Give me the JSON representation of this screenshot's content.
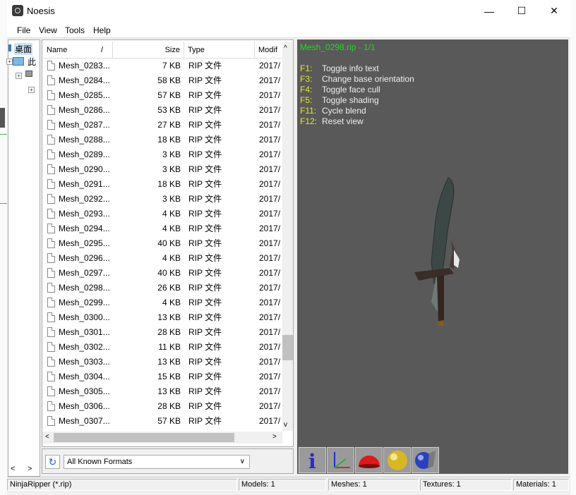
{
  "window": {
    "title": "Noesis",
    "minimize_glyph": "—",
    "maximize_glyph": "☐",
    "close_glyph": "✕"
  },
  "menu": [
    "File",
    "View",
    "Tools",
    "Help"
  ],
  "tree": {
    "desktop_label": "桌面",
    "pc_label": "此",
    "scroll_left": "<",
    "scroll_right": ">"
  },
  "file_list": {
    "columns": {
      "name": "Name",
      "sort_glyph": "/",
      "size": "Size",
      "type": "Type",
      "modified": "Modif"
    },
    "rows": [
      {
        "name": "Mesh_0283...",
        "size": "7 KB",
        "type": "RIP 文件",
        "date": "2017/"
      },
      {
        "name": "Mesh_0284...",
        "size": "58 KB",
        "type": "RIP 文件",
        "date": "2017/"
      },
      {
        "name": "Mesh_0285...",
        "size": "57 KB",
        "type": "RIP 文件",
        "date": "2017/"
      },
      {
        "name": "Mesh_0286...",
        "size": "53 KB",
        "type": "RIP 文件",
        "date": "2017/"
      },
      {
        "name": "Mesh_0287...",
        "size": "27 KB",
        "type": "RIP 文件",
        "date": "2017/"
      },
      {
        "name": "Mesh_0288...",
        "size": "18 KB",
        "type": "RIP 文件",
        "date": "2017/"
      },
      {
        "name": "Mesh_0289...",
        "size": "3 KB",
        "type": "RIP 文件",
        "date": "2017/"
      },
      {
        "name": "Mesh_0290...",
        "size": "3 KB",
        "type": "RIP 文件",
        "date": "2017/"
      },
      {
        "name": "Mesh_0291...",
        "size": "18 KB",
        "type": "RIP 文件",
        "date": "2017/"
      },
      {
        "name": "Mesh_0292...",
        "size": "3 KB",
        "type": "RIP 文件",
        "date": "2017/"
      },
      {
        "name": "Mesh_0293...",
        "size": "4 KB",
        "type": "RIP 文件",
        "date": "2017/"
      },
      {
        "name": "Mesh_0294...",
        "size": "4 KB",
        "type": "RIP 文件",
        "date": "2017/"
      },
      {
        "name": "Mesh_0295...",
        "size": "40 KB",
        "type": "RIP 文件",
        "date": "2017/"
      },
      {
        "name": "Mesh_0296...",
        "size": "4 KB",
        "type": "RIP 文件",
        "date": "2017/"
      },
      {
        "name": "Mesh_0297...",
        "size": "40 KB",
        "type": "RIP 文件",
        "date": "2017/"
      },
      {
        "name": "Mesh_0298...",
        "size": "26 KB",
        "type": "RIP 文件",
        "date": "2017/"
      },
      {
        "name": "Mesh_0299...",
        "size": "4 KB",
        "type": "RIP 文件",
        "date": "2017/"
      },
      {
        "name": "Mesh_0300...",
        "size": "13 KB",
        "type": "RIP 文件",
        "date": "2017/"
      },
      {
        "name": "Mesh_0301...",
        "size": "28 KB",
        "type": "RIP 文件",
        "date": "2017/"
      },
      {
        "name": "Mesh_0302...",
        "size": "11 KB",
        "type": "RIP 文件",
        "date": "2017/"
      },
      {
        "name": "Mesh_0303...",
        "size": "13 KB",
        "type": "RIP 文件",
        "date": "2017/"
      },
      {
        "name": "Mesh_0304...",
        "size": "15 KB",
        "type": "RIP 文件",
        "date": "2017/"
      },
      {
        "name": "Mesh_0305...",
        "size": "13 KB",
        "type": "RIP 文件",
        "date": "2017/"
      },
      {
        "name": "Mesh_0306...",
        "size": "28 KB",
        "type": "RIP 文件",
        "date": "2017/"
      },
      {
        "name": "Mesh_0307...",
        "size": "57 KB",
        "type": "RIP 文件",
        "date": "2017/"
      }
    ],
    "scroll_up": "^",
    "scroll_down": "v",
    "scroll_left": "<",
    "scroll_right": ">"
  },
  "format_bar": {
    "refresh_icon": "refresh-icon",
    "refresh_glyph": "↻",
    "selected_format": "All Known Formats",
    "chevron": "∨"
  },
  "viewport": {
    "title": "Mesh_0298.rip - 1/1",
    "background": "#595959",
    "title_color": "#1bdc1b",
    "key_color": "#e6e62a",
    "help": [
      {
        "key": "F1:",
        "text": "Toggle info text"
      },
      {
        "key": "F3:",
        "text": "Change base orientation"
      },
      {
        "key": "F4:",
        "text": "Toggle face cull"
      },
      {
        "key": "F5:",
        "text": "Toggle shading"
      },
      {
        "key": "F11:",
        "text": "Cycle blend"
      },
      {
        "key": "F12:",
        "text": "Reset view"
      }
    ]
  },
  "toolbar": {
    "info_glyph": "i",
    "buttons": [
      "info-icon",
      "axis-icon",
      "red-dome-icon",
      "yellow-sphere-icon",
      "blue-sphere-tool-icon"
    ]
  },
  "status": {
    "format": "NinjaRipper (*.rip)",
    "models": "Models: 1",
    "meshes": "Meshes: 1",
    "textures": "Textures: 1",
    "materials": "Materials: 1"
  }
}
